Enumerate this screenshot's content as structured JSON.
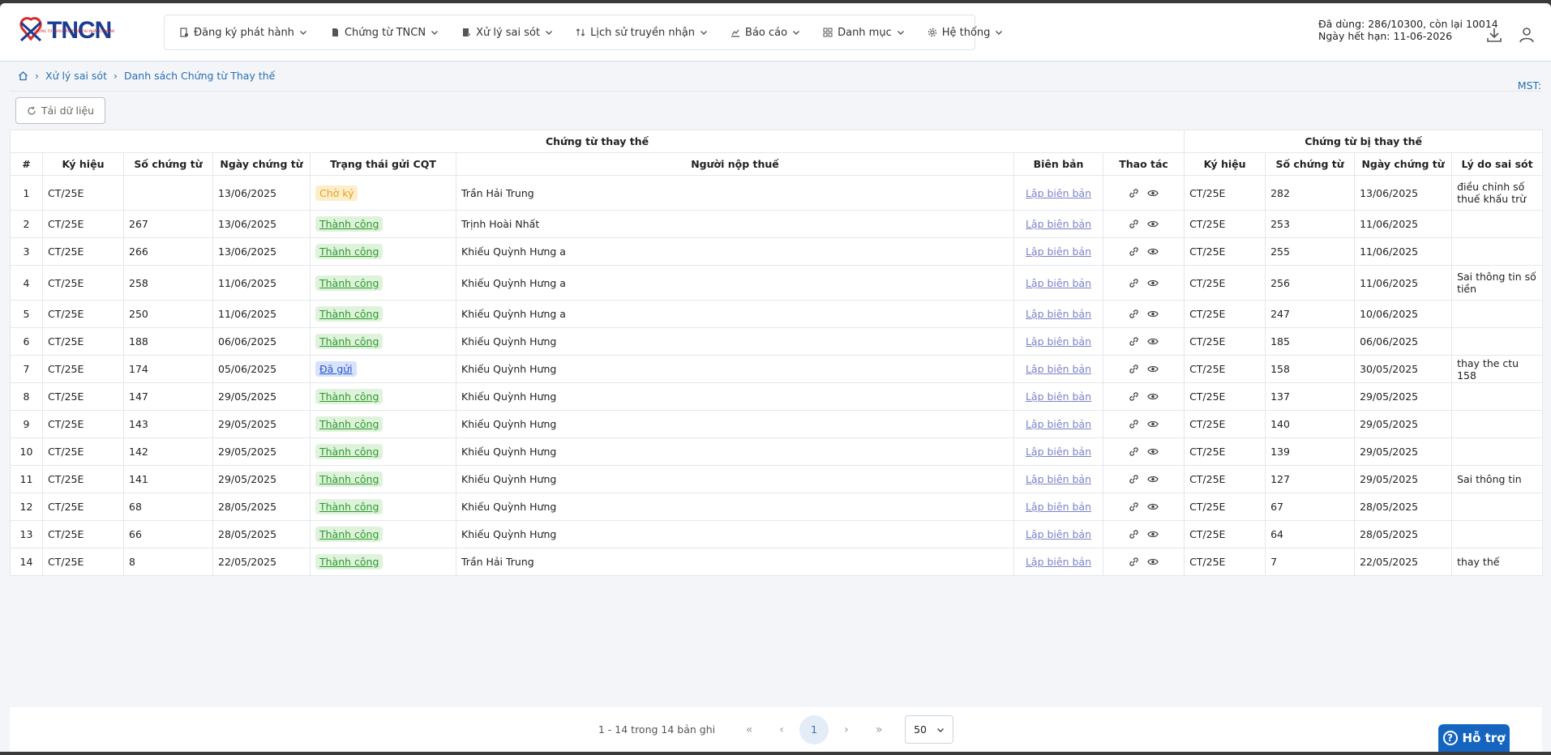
{
  "brand": {
    "name": "TNCN",
    "tagline": "CHỨNG TỪ KHẤU TRỪ THUẾ THU NHẬP CÁ NHÂN"
  },
  "nav": [
    {
      "label": "Đăng ký phát hành",
      "icon": "doc-gear-icon"
    },
    {
      "label": "Chứng từ TNCN",
      "icon": "document-icon"
    },
    {
      "label": "Xử lý sai sót",
      "icon": "doc-edit-icon"
    },
    {
      "label": "Lịch sử truyền nhận",
      "icon": "sort-arrows-icon"
    },
    {
      "label": "Báo cáo",
      "icon": "chart-icon"
    },
    {
      "label": "Danh mục",
      "icon": "grid-icon"
    },
    {
      "label": "Hệ thống",
      "icon": "gear-icon"
    }
  ],
  "quota": {
    "line1": "Đã dùng: 286/10300, còn lại 10014",
    "line2": "Ngày hết hạn: 11-06-2026"
  },
  "breadcrumb": {
    "level1": "Xử lý sai sót",
    "level2": "Danh sách Chứng từ Thay thế"
  },
  "mst_label": "MST:",
  "toolbar": {
    "reload_label": "Tải dữ liệu"
  },
  "table": {
    "group_replacing": "Chứng từ thay thế",
    "group_replaced": "Chứng từ bị thay thế",
    "headers": [
      "#",
      "Ký hiệu",
      "Số chứng từ",
      "Ngày chứng từ",
      "Trạng thái gửi CQT",
      "Người nộp thuế",
      "Biên bản",
      "Thao tác",
      "Ký hiệu",
      "Số chứng từ",
      "Ngày chứng từ",
      "Lý do sai sót"
    ],
    "link_label": "Lập biên bản",
    "rows": [
      {
        "idx": "1",
        "kyhieu": "CT/25E",
        "so": "",
        "ngay": "13/06/2025",
        "status": "Chờ ký",
        "stype": "wait",
        "nnt": "Trần Hải Trung",
        "kyhieu2": "CT/25E",
        "so2": "282",
        "ngay2": "13/06/2025",
        "lydo": "điều chỉnh số thuế khấu trừ",
        "tall": true
      },
      {
        "idx": "2",
        "kyhieu": "CT/25E",
        "so": "267",
        "ngay": "13/06/2025",
        "status": "Thành công",
        "stype": "ok",
        "nnt": "Trịnh Hoài Nhất",
        "kyhieu2": "CT/25E",
        "so2": "253",
        "ngay2": "11/06/2025",
        "lydo": ""
      },
      {
        "idx": "3",
        "kyhieu": "CT/25E",
        "so": "266",
        "ngay": "13/06/2025",
        "status": "Thành công",
        "stype": "ok",
        "nnt": "Khiếu Quỳnh Hưng a",
        "kyhieu2": "CT/25E",
        "so2": "255",
        "ngay2": "11/06/2025",
        "lydo": ""
      },
      {
        "idx": "4",
        "kyhieu": "CT/25E",
        "so": "258",
        "ngay": "11/06/2025",
        "status": "Thành công",
        "stype": "ok",
        "nnt": "Khiếu Quỳnh Hưng a",
        "kyhieu2": "CT/25E",
        "so2": "256",
        "ngay2": "11/06/2025",
        "lydo": "Sai thông tin số tiền",
        "tall": true
      },
      {
        "idx": "5",
        "kyhieu": "CT/25E",
        "so": "250",
        "ngay": "11/06/2025",
        "status": "Thành công",
        "stype": "ok",
        "nnt": "Khiếu Quỳnh Hưng a",
        "kyhieu2": "CT/25E",
        "so2": "247",
        "ngay2": "10/06/2025",
        "lydo": ""
      },
      {
        "idx": "6",
        "kyhieu": "CT/25E",
        "so": "188",
        "ngay": "06/06/2025",
        "status": "Thành công",
        "stype": "ok",
        "nnt": "Khiếu Quỳnh Hưng",
        "kyhieu2": "CT/25E",
        "so2": "185",
        "ngay2": "06/06/2025",
        "lydo": ""
      },
      {
        "idx": "7",
        "kyhieu": "CT/25E",
        "so": "174",
        "ngay": "05/06/2025",
        "status": "Đã gửi",
        "stype": "sent",
        "nnt": "Khiếu Quỳnh Hưng",
        "kyhieu2": "CT/25E",
        "so2": "158",
        "ngay2": "30/05/2025",
        "lydo": "thay the ctu 158"
      },
      {
        "idx": "8",
        "kyhieu": "CT/25E",
        "so": "147",
        "ngay": "29/05/2025",
        "status": "Thành công",
        "stype": "ok",
        "nnt": "Khiếu Quỳnh Hưng",
        "kyhieu2": "CT/25E",
        "so2": "137",
        "ngay2": "29/05/2025",
        "lydo": ""
      },
      {
        "idx": "9",
        "kyhieu": "CT/25E",
        "so": "143",
        "ngay": "29/05/2025",
        "status": "Thành công",
        "stype": "ok",
        "nnt": "Khiếu Quỳnh Hưng",
        "kyhieu2": "CT/25E",
        "so2": "140",
        "ngay2": "29/05/2025",
        "lydo": ""
      },
      {
        "idx": "10",
        "kyhieu": "CT/25E",
        "so": "142",
        "ngay": "29/05/2025",
        "status": "Thành công",
        "stype": "ok",
        "nnt": "Khiếu Quỳnh Hưng",
        "kyhieu2": "CT/25E",
        "so2": "139",
        "ngay2": "29/05/2025",
        "lydo": ""
      },
      {
        "idx": "11",
        "kyhieu": "CT/25E",
        "so": "141",
        "ngay": "29/05/2025",
        "status": "Thành công",
        "stype": "ok",
        "nnt": "Khiếu Quỳnh Hưng",
        "kyhieu2": "CT/25E",
        "so2": "127",
        "ngay2": "29/05/2025",
        "lydo": "Sai thông tin"
      },
      {
        "idx": "12",
        "kyhieu": "CT/25E",
        "so": "68",
        "ngay": "28/05/2025",
        "status": "Thành công",
        "stype": "ok",
        "nnt": "Khiếu Quỳnh Hưng",
        "kyhieu2": "CT/25E",
        "so2": "67",
        "ngay2": "28/05/2025",
        "lydo": ""
      },
      {
        "idx": "13",
        "kyhieu": "CT/25E",
        "so": "66",
        "ngay": "28/05/2025",
        "status": "Thành công",
        "stype": "ok",
        "nnt": "Khiếu Quỳnh Hưng",
        "kyhieu2": "CT/25E",
        "so2": "64",
        "ngay2": "28/05/2025",
        "lydo": ""
      },
      {
        "idx": "14",
        "kyhieu": "CT/25E",
        "so": "8",
        "ngay": "22/05/2025",
        "status": "Thành công",
        "stype": "ok",
        "nnt": "Trần Hải Trung",
        "kyhieu2": "CT/25E",
        "so2": "7",
        "ngay2": "22/05/2025",
        "lydo": "thay thế"
      }
    ]
  },
  "pagination": {
    "info": "1 - 14 trong 14 bản ghi",
    "current": "1",
    "page_size": "50"
  },
  "help": {
    "label": "Hỗ trợ"
  },
  "colors": {
    "accent": "#1565c0",
    "link": "#2a6fb0",
    "success": "#2c9a2c",
    "warning": "#e6a11c"
  }
}
